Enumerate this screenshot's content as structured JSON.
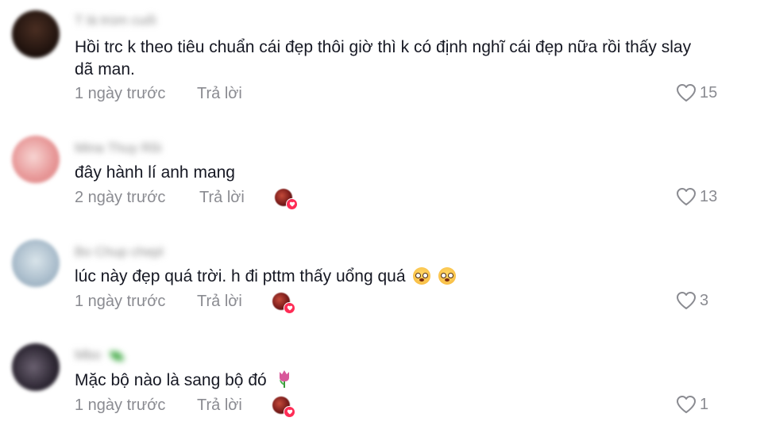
{
  "comments": [
    {
      "username": "T là trùm cuối",
      "text_lines": [
        "Hồi trc k theo tiêu chuẩn cái đẹp thôi giờ thì k có định nghĩ cái đẹp nữa rồi thấy slay",
        "dã man."
      ],
      "time": "1 ngày trước",
      "reply_label": "Trả lời",
      "likes": "15",
      "creator_liked": false,
      "avatar_color": "#2a1a14"
    },
    {
      "username": "Mina Thuy Rồi",
      "text_lines": [
        "đây hành lí anh mang"
      ],
      "time": "2 ngày trước",
      "reply_label": "Trả lời",
      "likes": "13",
      "creator_liked": true,
      "avatar_color": "#f2b6b6"
    },
    {
      "username": "Bo Chup chepl",
      "text_lines": [
        "lúc này đẹp quá trời. h đi pttm thấy uổng quá"
      ],
      "emoji": "flushed-face",
      "time": "1 ngày trước",
      "reply_label": "Trả lời",
      "likes": "3",
      "creator_liked": true,
      "avatar_color": "#b9cad6"
    },
    {
      "username": "Mbo",
      "text_lines": [
        "Mặc bộ nào là sang bộ đó"
      ],
      "emoji": "tulip",
      "time": "1 ngày trước",
      "reply_label": "Trả lời",
      "likes": "1",
      "creator_liked": true,
      "avatar_color": "#3a3440"
    }
  ],
  "colors": {
    "text": "#161823",
    "muted": "#8a8b91",
    "accent": "#fe2c55"
  }
}
